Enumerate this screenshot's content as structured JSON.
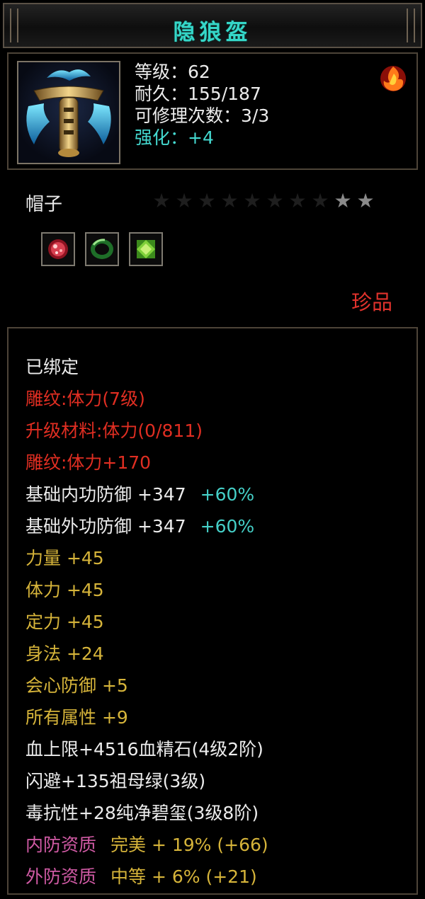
{
  "title": "隐狼盔",
  "stats": {
    "level": "等级：62",
    "durability": "耐久：155/187",
    "repair": "可修理次数：3/3",
    "enhance": "强化：+4"
  },
  "item_type": "帽子",
  "stars": {
    "filled": 2,
    "total": 10
  },
  "gems": [
    "red-gem-icon",
    "green-jade-icon",
    "green-crystal-icon"
  ],
  "rarity": "珍品",
  "attributes": [
    {
      "text": "已绑定",
      "color": "white"
    },
    {
      "text": "雕纹:体力(7级)",
      "color": "red"
    },
    {
      "text": "升级材料:体力(0/811)",
      "color": "red"
    },
    {
      "text": "雕纹:体力+170",
      "color": "red"
    },
    {
      "text": "基础内功防御 +347",
      "pct": "+60%",
      "color": "white"
    },
    {
      "text": "基础外功防御 +347",
      "pct": "+60%",
      "color": "white"
    },
    {
      "text": "力量 +45",
      "color": "gold"
    },
    {
      "text": "体力 +45",
      "color": "gold"
    },
    {
      "text": "定力 +45",
      "color": "gold"
    },
    {
      "text": "身法 +24",
      "color": "gold"
    },
    {
      "text": "会心防御 +5",
      "color": "gold"
    },
    {
      "text": "所有属性 +9",
      "color": "gold"
    },
    {
      "text": "血上限+4516血精石(4级2阶)",
      "color": "white"
    },
    {
      "text": "闪避+135祖母绿(3级)",
      "color": "white"
    },
    {
      "text": "毒抗性+28纯净碧玺(3级8阶)",
      "color": "white"
    },
    {
      "text": "内防资质",
      "value": "完美 + 19% (+66)",
      "color": "pink"
    },
    {
      "text": "外防资质",
      "value": "中等 + 6% (+21)",
      "color": "pink"
    }
  ],
  "colors": {
    "title": "#35d7c8",
    "cyan": "#44d9d0",
    "red": "#e02e22",
    "gold": "#d6b43a",
    "pink": "#d05aa4",
    "rarity": "#e0322c"
  }
}
